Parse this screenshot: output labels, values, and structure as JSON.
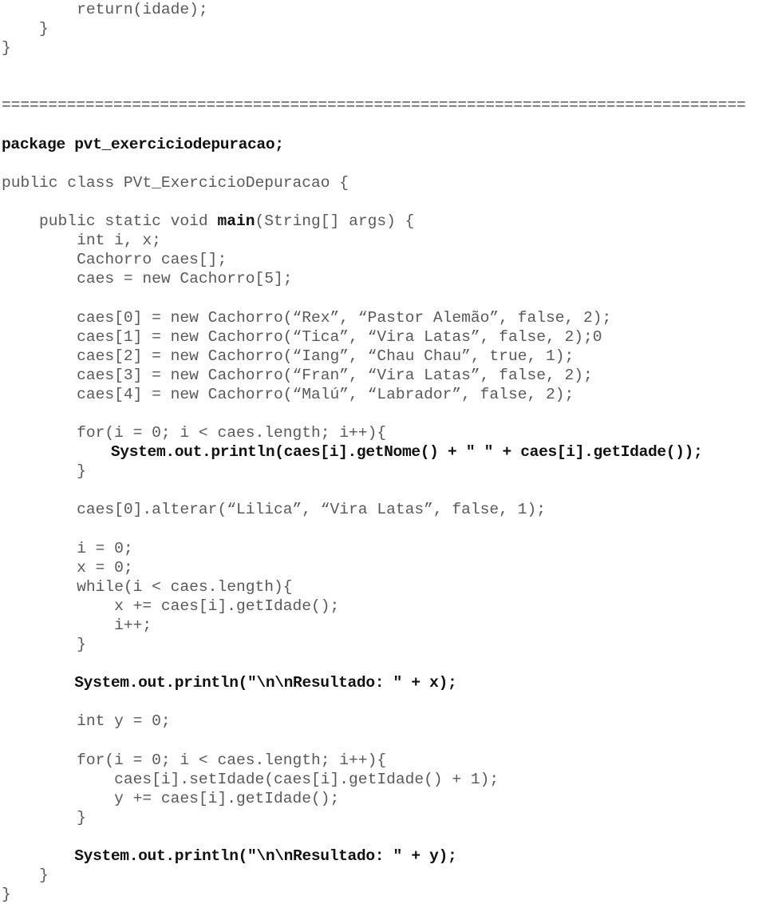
{
  "document": {
    "kind": "java-source-listing",
    "language": "Java",
    "package_name": "pvt_exerciciodepuracao",
    "class_name": "PVt_ExercicioDepuracao",
    "text_color": "#595959",
    "bold_color": "#111111",
    "background_color": "#ffffff",
    "separator_rule": "================================================================================"
  },
  "lines": [
    {
      "id": "l01",
      "text": "        return(idade);",
      "style": "plain"
    },
    {
      "id": "l02",
      "text": "    }",
      "style": "plain"
    },
    {
      "id": "l03",
      "text": "}",
      "style": "plain"
    },
    {
      "id": "l04",
      "text": "",
      "style": "blank"
    },
    {
      "id": "l05",
      "text": "",
      "style": "blank"
    },
    {
      "id": "l06",
      "text": "================================================================================",
      "style": "sep"
    },
    {
      "id": "l07",
      "text": "",
      "style": "blank"
    },
    {
      "id": "l08",
      "text": "package pvt_exerciciodepuracao;",
      "style": "bold"
    },
    {
      "id": "l09",
      "text": "",
      "style": "blank"
    },
    {
      "id": "l10",
      "text": "public class PVt_ExercicioDepuracao {",
      "style": "plain"
    },
    {
      "id": "l11",
      "text": "",
      "style": "blank"
    },
    {
      "id": "l12",
      "style": "mixed",
      "segments": [
        {
          "text": "    public static void ",
          "bold": false
        },
        {
          "text": "main",
          "bold": true
        },
        {
          "text": "(String[] args) {",
          "bold": false
        }
      ]
    },
    {
      "id": "l13",
      "text": "        int i, x;",
      "style": "plain"
    },
    {
      "id": "l14",
      "text": "        Cachorro caes[];",
      "style": "plain"
    },
    {
      "id": "l15",
      "text": "        caes = new Cachorro[5];",
      "style": "plain"
    },
    {
      "id": "l16",
      "text": "",
      "style": "blank"
    },
    {
      "id": "l17",
      "text": "        caes[0] = new Cachorro(“Rex”, “Pastor Alemão”, false, 2);",
      "style": "plain"
    },
    {
      "id": "l18",
      "text": "        caes[1] = new Cachorro(“Tica”, “Vira Latas”, false, 2);0",
      "style": "plain"
    },
    {
      "id": "l19",
      "text": "        caes[2] = new Cachorro(“Iang”, “Chau Chau”, true, 1);",
      "style": "plain"
    },
    {
      "id": "l20",
      "text": "        caes[3] = new Cachorro(“Fran”, “Vira Latas”, false, 2);",
      "style": "plain"
    },
    {
      "id": "l21",
      "text": "        caes[4] = new Cachorro(“Malú”, “Labrador”, false, 2);",
      "style": "plain"
    },
    {
      "id": "l22",
      "text": "",
      "style": "blank"
    },
    {
      "id": "l23",
      "text": "        for(i = 0; i < caes.length; i++){",
      "style": "plain"
    },
    {
      "id": "l24",
      "text": "            System.out.println(caes[i].getNome() + \" \" + caes[i].getIdade());",
      "style": "bold"
    },
    {
      "id": "l25",
      "text": "        }",
      "style": "plain"
    },
    {
      "id": "l26",
      "text": "",
      "style": "blank"
    },
    {
      "id": "l27",
      "text": "        caes[0].alterar(“Lilica”, “Vira Latas”, false, 1);",
      "style": "plain"
    },
    {
      "id": "l28",
      "text": "",
      "style": "blank"
    },
    {
      "id": "l29",
      "text": "        i = 0;",
      "style": "plain"
    },
    {
      "id": "l30",
      "text": "        x = 0;",
      "style": "plain"
    },
    {
      "id": "l31",
      "text": "        while(i < caes.length){",
      "style": "plain"
    },
    {
      "id": "l32",
      "text": "            x += caes[i].getIdade();",
      "style": "plain"
    },
    {
      "id": "l33",
      "text": "            i++;",
      "style": "plain"
    },
    {
      "id": "l34",
      "text": "        }",
      "style": "plain"
    },
    {
      "id": "l35",
      "text": "",
      "style": "blank"
    },
    {
      "id": "l36",
      "text": "        System.out.println(\"\\n\\nResultado: \" + x);",
      "style": "bold"
    },
    {
      "id": "l37",
      "text": "",
      "style": "blank"
    },
    {
      "id": "l38",
      "text": "        int y = 0;",
      "style": "plain"
    },
    {
      "id": "l39",
      "text": "",
      "style": "blank"
    },
    {
      "id": "l40",
      "text": "        for(i = 0; i < caes.length; i++){",
      "style": "plain"
    },
    {
      "id": "l41",
      "text": "            caes[i].setIdade(caes[i].getIdade() + 1);",
      "style": "plain"
    },
    {
      "id": "l42",
      "text": "            y += caes[i].getIdade();",
      "style": "plain"
    },
    {
      "id": "l43",
      "text": "        }",
      "style": "plain"
    },
    {
      "id": "l44",
      "text": "",
      "style": "blank"
    },
    {
      "id": "l45",
      "text": "        System.out.println(\"\\n\\nResultado: \" + y);",
      "style": "bold"
    },
    {
      "id": "l46",
      "text": "    }",
      "style": "plain"
    },
    {
      "id": "l47",
      "text": "}",
      "style": "plain"
    }
  ]
}
